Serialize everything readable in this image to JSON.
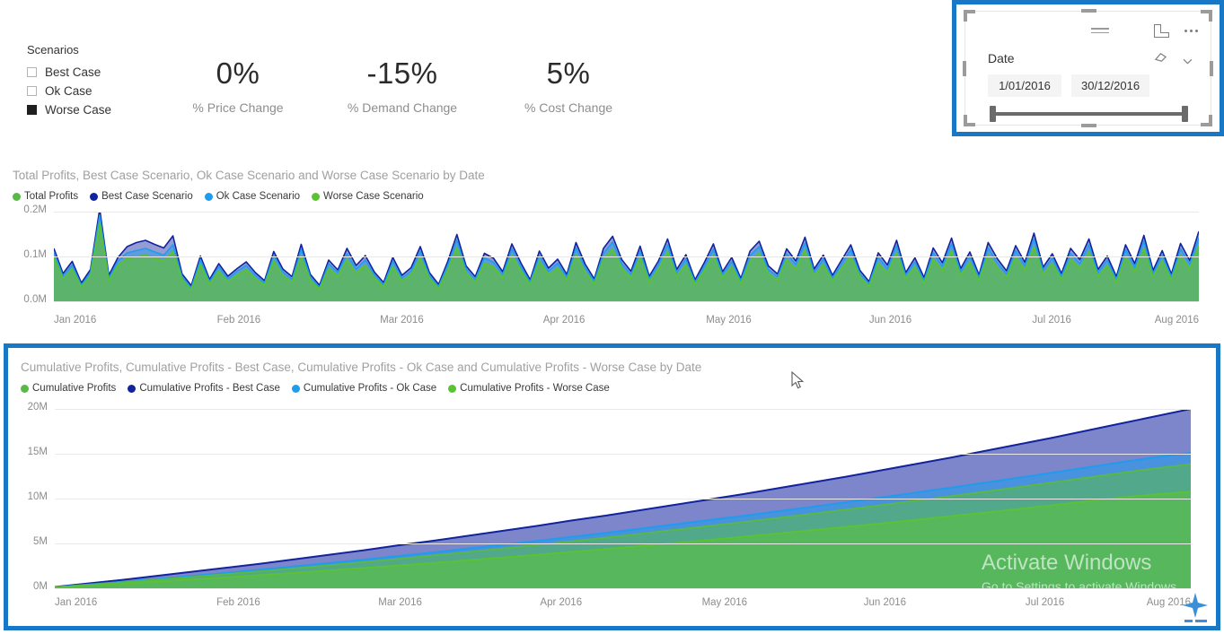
{
  "scenario_slicer": {
    "title": "Scenarios",
    "items": [
      {
        "label": "Best Case",
        "checked": false
      },
      {
        "label": "Ok Case",
        "checked": false
      },
      {
        "label": "Worse Case",
        "checked": true
      }
    ]
  },
  "kpis": [
    {
      "value": "0%",
      "label": "% Price Change"
    },
    {
      "value": "-15%",
      "label": "% Demand Change"
    },
    {
      "value": "5%",
      "label": "% Cost Change"
    }
  ],
  "date_slicer": {
    "field_label": "Date",
    "start_date": "1/01/2016",
    "end_date": "30/12/2016",
    "icons": [
      "hamburger-menu-icon",
      "focus-mode-icon",
      "more-options-icon",
      "eraser-icon",
      "chevron-down-icon"
    ],
    "selected": true,
    "selection_color": "#1878c6"
  },
  "watermark": {
    "line1": "Activate Windows",
    "line2": "Go to Settings to activate Windows."
  },
  "colors": {
    "total_profits": "#58b947",
    "best_case": "#12239e",
    "ok_case": "#1f9ced",
    "worse_case": "#5bc236",
    "selection_blue": "#1878c6",
    "grid": "#e9e9e9",
    "axis_text": "#8c8c8c",
    "title_text": "#a0a0a0"
  },
  "chart_data": [
    {
      "id": "daily-profits",
      "type": "area",
      "title": "Total Profits, Best Case Scenario, Ok Case Scenario and Worse Case Scenario by Date",
      "xlabel": "",
      "ylabel": "",
      "ylim": [
        0,
        0.2
      ],
      "yticks": [
        "0.0M",
        "0.1M",
        "0.2M"
      ],
      "ytick_values": [
        0,
        0.1,
        0.2
      ],
      "xticks": [
        "Jan 2016",
        "Feb 2016",
        "Mar 2016",
        "Apr 2016",
        "May 2016",
        "Jun 2016",
        "Jul 2016",
        "Aug 2016"
      ],
      "grid": true,
      "legend_position": "top-left",
      "legend": [
        "Total Profits",
        "Best Case Scenario",
        "Ok Case Scenario",
        "Worse Case Scenario"
      ],
      "series": [
        {
          "name": "Best Case Scenario",
          "color": "#12239e",
          "values": [
            0.118,
            0.062,
            0.089,
            0.041,
            0.071,
            0.206,
            0.058,
            0.098,
            0.122,
            0.131,
            0.136,
            0.127,
            0.119,
            0.146,
            0.061,
            0.035,
            0.101,
            0.049,
            0.084,
            0.056,
            0.073,
            0.088,
            0.064,
            0.046,
            0.111,
            0.072,
            0.055,
            0.127,
            0.06,
            0.036,
            0.092,
            0.07,
            0.118,
            0.08,
            0.102,
            0.065,
            0.042,
            0.098,
            0.058,
            0.075,
            0.122,
            0.064,
            0.038,
            0.089,
            0.149,
            0.079,
            0.055,
            0.107,
            0.096,
            0.066,
            0.128,
            0.085,
            0.048,
            0.112,
            0.074,
            0.094,
            0.06,
            0.131,
            0.083,
            0.05,
            0.118,
            0.145,
            0.093,
            0.067,
            0.123,
            0.056,
            0.09,
            0.139,
            0.071,
            0.104,
            0.048,
            0.086,
            0.128,
            0.066,
            0.098,
            0.051,
            0.112,
            0.134,
            0.079,
            0.061,
            0.117,
            0.09,
            0.143,
            0.072,
            0.103,
            0.058,
            0.092,
            0.126,
            0.069,
            0.044,
            0.108,
            0.081,
            0.136,
            0.064,
            0.097,
            0.053,
            0.119,
            0.086,
            0.141,
            0.073,
            0.11,
            0.059,
            0.131,
            0.095,
            0.068,
            0.124,
            0.087,
            0.152,
            0.076,
            0.106,
            0.062,
            0.118,
            0.093,
            0.139,
            0.071,
            0.101,
            0.055,
            0.126,
            0.084,
            0.147,
            0.069,
            0.113,
            0.061,
            0.129,
            0.091,
            0.156
          ]
        },
        {
          "name": "Ok Case Scenario",
          "color": "#1f9ced",
          "values": [
            0.11,
            0.056,
            0.081,
            0.036,
            0.065,
            0.192,
            0.052,
            0.09,
            0.108,
            0.113,
            0.118,
            0.11,
            0.103,
            0.126,
            0.055,
            0.03,
            0.093,
            0.044,
            0.077,
            0.05,
            0.067,
            0.08,
            0.058,
            0.041,
            0.102,
            0.066,
            0.049,
            0.116,
            0.054,
            0.031,
            0.084,
            0.064,
            0.106,
            0.072,
            0.092,
            0.059,
            0.037,
            0.089,
            0.052,
            0.068,
            0.111,
            0.058,
            0.033,
            0.081,
            0.136,
            0.072,
            0.049,
            0.097,
            0.087,
            0.06,
            0.117,
            0.077,
            0.043,
            0.102,
            0.067,
            0.085,
            0.054,
            0.119,
            0.075,
            0.045,
            0.107,
            0.132,
            0.084,
            0.06,
            0.112,
            0.05,
            0.082,
            0.126,
            0.064,
            0.094,
            0.043,
            0.078,
            0.116,
            0.06,
            0.089,
            0.046,
            0.102,
            0.122,
            0.071,
            0.055,
            0.106,
            0.082,
            0.13,
            0.065,
            0.094,
            0.052,
            0.084,
            0.115,
            0.062,
            0.039,
            0.098,
            0.073,
            0.124,
            0.058,
            0.088,
            0.047,
            0.108,
            0.078,
            0.128,
            0.066,
            0.1,
            0.053,
            0.119,
            0.086,
            0.061,
            0.113,
            0.079,
            0.138,
            0.069,
            0.096,
            0.056,
            0.107,
            0.084,
            0.126,
            0.064,
            0.092,
            0.049,
            0.115,
            0.076,
            0.134,
            0.062,
            0.103,
            0.055,
            0.117,
            0.083,
            0.142
          ]
        },
        {
          "name": "Total Profits",
          "color": "#58b947",
          "values": [
            0.1,
            0.05,
            0.073,
            0.032,
            0.058,
            0.176,
            0.046,
            0.081,
            0.096,
            0.1,
            0.104,
            0.097,
            0.091,
            0.112,
            0.049,
            0.026,
            0.083,
            0.039,
            0.068,
            0.044,
            0.059,
            0.071,
            0.051,
            0.036,
            0.091,
            0.058,
            0.043,
            0.103,
            0.047,
            0.027,
            0.074,
            0.056,
            0.094,
            0.063,
            0.081,
            0.052,
            0.032,
            0.078,
            0.046,
            0.06,
            0.098,
            0.051,
            0.029,
            0.071,
            0.121,
            0.063,
            0.043,
            0.086,
            0.077,
            0.053,
            0.104,
            0.068,
            0.038,
            0.09,
            0.059,
            0.075,
            0.047,
            0.105,
            0.066,
            0.039,
            0.095,
            0.117,
            0.074,
            0.053,
            0.099,
            0.044,
            0.072,
            0.112,
            0.056,
            0.083,
            0.038,
            0.069,
            0.103,
            0.053,
            0.078,
            0.04,
            0.09,
            0.108,
            0.062,
            0.048,
            0.094,
            0.072,
            0.115,
            0.057,
            0.083,
            0.046,
            0.074,
            0.101,
            0.055,
            0.034,
            0.086,
            0.064,
            0.109,
            0.051,
            0.078,
            0.041,
            0.095,
            0.069,
            0.113,
            0.058,
            0.088,
            0.047,
            0.105,
            0.076,
            0.054,
            0.1,
            0.07,
            0.122,
            0.061,
            0.085,
            0.049,
            0.094,
            0.074,
            0.111,
            0.056,
            0.081,
            0.043,
            0.101,
            0.067,
            0.118,
            0.055,
            0.091,
            0.048,
            0.103,
            0.073,
            0.125
          ]
        },
        {
          "name": "Worse Case Scenario",
          "color": "#5bc236",
          "values": [
            0.098,
            0.049,
            0.071,
            0.031,
            0.057,
            0.172,
            0.045,
            0.079,
            0.094,
            0.098,
            0.102,
            0.095,
            0.089,
            0.11,
            0.048,
            0.025,
            0.081,
            0.038,
            0.066,
            0.043,
            0.058,
            0.069,
            0.05,
            0.035,
            0.089,
            0.057,
            0.042,
            0.101,
            0.046,
            0.026,
            0.072,
            0.055,
            0.092,
            0.062,
            0.079,
            0.051,
            0.031,
            0.076,
            0.045,
            0.059,
            0.096,
            0.05,
            0.028,
            0.069,
            0.118,
            0.062,
            0.042,
            0.084,
            0.075,
            0.052,
            0.102,
            0.066,
            0.037,
            0.088,
            0.058,
            0.073,
            0.046,
            0.103,
            0.065,
            0.038,
            0.093,
            0.115,
            0.072,
            0.052,
            0.097,
            0.043,
            0.07,
            0.11,
            0.055,
            0.081,
            0.037,
            0.067,
            0.101,
            0.052,
            0.076,
            0.039,
            0.088,
            0.106,
            0.061,
            0.047,
            0.092,
            0.07,
            0.113,
            0.056,
            0.081,
            0.045,
            0.072,
            0.099,
            0.054,
            0.033,
            0.084,
            0.062,
            0.107,
            0.05,
            0.076,
            0.04,
            0.093,
            0.067,
            0.111,
            0.057,
            0.086,
            0.046,
            0.103,
            0.074,
            0.053,
            0.098,
            0.068,
            0.12,
            0.06,
            0.083,
            0.048,
            0.092,
            0.072,
            0.109,
            0.055,
            0.079,
            0.042,
            0.099,
            0.065,
            0.116,
            0.054,
            0.089,
            0.047,
            0.101,
            0.071,
            0.123
          ]
        }
      ]
    },
    {
      "id": "cumulative-profits",
      "type": "area",
      "title": "Cumulative Profits, Cumulative Profits - Best Case, Cumulative Profits - Ok Case and Cumulative Profits - Worse Case by Date",
      "xlabel": "",
      "ylabel": "",
      "ylim": [
        0,
        20
      ],
      "yticks": [
        "0M",
        "5M",
        "10M",
        "15M",
        "20M"
      ],
      "ytick_values": [
        0,
        5,
        10,
        15,
        20
      ],
      "xticks": [
        "Jan 2016",
        "Feb 2016",
        "Mar 2016",
        "Apr 2016",
        "May 2016",
        "Jun 2016",
        "Jul 2016",
        "Aug 2016"
      ],
      "grid": true,
      "legend_position": "top-left",
      "legend": [
        "Cumulative Profits",
        "Cumulative Profits - Best Case",
        "Cumulative Profits - Ok Case",
        "Cumulative Profits - Worse Case"
      ],
      "series": [
        {
          "name": "Cumulative Profits - Best Case",
          "color": "#12239e",
          "values": [
            0.15,
            0.55,
            0.95,
            1.4,
            1.85,
            2.3,
            2.75,
            3.25,
            3.75,
            4.25,
            4.8,
            5.3,
            5.85,
            6.4,
            6.95,
            7.55,
            8.1,
            8.7,
            9.3,
            9.9,
            10.5,
            11.15,
            11.8,
            12.45,
            13.15,
            13.85,
            14.55,
            15.3,
            16.05,
            16.8,
            17.6,
            18.4,
            19.2,
            20.0
          ]
        },
        {
          "name": "Cumulative Profits - Ok Case",
          "color": "#1f9ced",
          "values": [
            0.12,
            0.42,
            0.72,
            1.05,
            1.38,
            1.72,
            2.08,
            2.45,
            2.82,
            3.2,
            3.6,
            4.0,
            4.42,
            4.85,
            5.28,
            5.72,
            6.18,
            6.64,
            7.12,
            7.6,
            8.08,
            8.58,
            9.08,
            9.6,
            10.12,
            10.66,
            11.2,
            11.76,
            12.32,
            12.9,
            13.48,
            14.08,
            14.62,
            15.1
          ]
        },
        {
          "name": "Cumulative Profits",
          "color": "#58b947",
          "values": [
            0.1,
            0.38,
            0.66,
            0.96,
            1.26,
            1.57,
            1.9,
            2.23,
            2.57,
            2.92,
            3.28,
            3.65,
            4.03,
            4.42,
            4.82,
            5.22,
            5.64,
            6.06,
            6.5,
            6.94,
            7.38,
            7.84,
            8.3,
            8.78,
            9.26,
            9.75,
            10.25,
            10.76,
            11.28,
            11.8,
            12.34,
            12.88,
            13.38,
            13.82
          ]
        },
        {
          "name": "Cumulative Profits - Worse Case",
          "color": "#5bc236",
          "values": [
            0.08,
            0.3,
            0.52,
            0.75,
            0.98,
            1.22,
            1.47,
            1.73,
            1.99,
            2.26,
            2.54,
            2.83,
            3.12,
            3.42,
            3.73,
            4.05,
            4.37,
            4.7,
            5.04,
            5.39,
            5.74,
            6.1,
            6.47,
            6.85,
            7.23,
            7.62,
            8.02,
            8.43,
            8.84,
            9.26,
            9.69,
            10.12,
            10.48,
            10.78
          ]
        }
      ]
    }
  ]
}
